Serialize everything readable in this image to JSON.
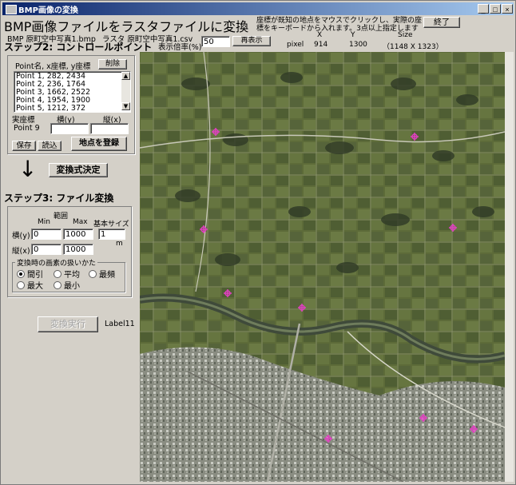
{
  "window": {
    "title": "BMP画像の変換",
    "minimize": "_",
    "maximize": "□",
    "close": "×"
  },
  "header": {
    "main_title": "BMP画像ファイルをラスタファイルに変換",
    "instruction": "座標が既知の地点をマウスでクリックし、実際の座標をキーボードから入れます。3点以上指定します",
    "exit_button": "終了",
    "bmp_file_label": "BMP",
    "bmp_file_name": "原町空中写真1.bmp",
    "raster_file_label": "ラスタ",
    "raster_file_name": "原町空中写真1.csv",
    "zoom_label": "表示倍率(%)",
    "zoom_value": "50",
    "redisplay_button": "再表示",
    "col_x": "X",
    "col_y": "Y",
    "col_size": "Size",
    "pixel_label": "pixel",
    "pixel_x": "914",
    "pixel_y": "1300",
    "size_value": "（1148 X 1323）"
  },
  "step2": {
    "title": "ステップ2: コントロールポイント",
    "list_header": "Point名, x座標, y座標",
    "delete_button": "削除",
    "points": [
      "Point 1, 282, 2434",
      "Point 2, 236, 1764",
      "Point 3, 1662, 2522",
      "Point 4, 1954, 1900",
      "Point 5, 1212, 372"
    ],
    "real_coord_label": "実座標",
    "horiz_label": "横(y)",
    "vert_label": "縦(x)",
    "point_name": "Point 9",
    "horiz_value": "",
    "vert_value": "",
    "save_button": "保存",
    "load_button": "読込",
    "register_button": "地点を登録"
  },
  "transform": {
    "arrow": "↓",
    "decide_button": "変換式決定"
  },
  "step3": {
    "title": "ステップ3:  ファイル変換",
    "range_label": "範囲",
    "min_label": "Min",
    "max_label": "Max",
    "base_size_label": "基本サイズ",
    "horiz_label": "横(y)",
    "vert_label": "縦(x)",
    "horiz_min": "0",
    "horiz_max": "1000",
    "vert_min": "0",
    "vert_max": "1000",
    "base_size": "1",
    "unit": "m",
    "pixel_group_label": "変換時の画素の扱いかた",
    "options": [
      "間引",
      "平均",
      "最頻",
      "最大",
      "最小"
    ],
    "selected_option": "間引",
    "execute_button": "変換実行",
    "status_label": "Label11"
  },
  "colors": {
    "title_bar": "#0a246a",
    "window_bg": "#d4d0c8",
    "marker": "#e040c0",
    "field_green": "#5c6a38",
    "river": "#3f4a3a"
  },
  "photo": {
    "icon": "aerial-photo-image",
    "marker_count": 9
  }
}
